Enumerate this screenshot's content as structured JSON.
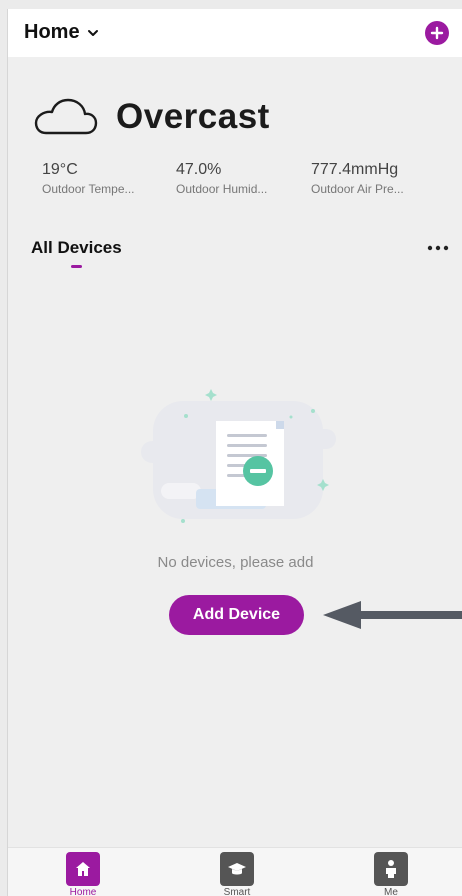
{
  "header": {
    "home_label": "Home",
    "add_icon": "plus-circle-icon"
  },
  "weather": {
    "condition": "Overcast",
    "icon": "cloud-icon",
    "stats": [
      {
        "value": "19°C",
        "label": "Outdoor Tempe..."
      },
      {
        "value": "47.0%",
        "label": "Outdoor Humid..."
      },
      {
        "value": "777.4mmHg",
        "label": "Outdoor Air Pre..."
      }
    ]
  },
  "devices": {
    "section_title": "All Devices",
    "more_icon": "more-icon",
    "empty_message": "No devices, please add",
    "add_button_label": "Add Device"
  },
  "nav": {
    "items": [
      {
        "label": "Home",
        "icon": "home-icon",
        "active": true
      },
      {
        "label": "Smart",
        "icon": "graduation-cap-icon",
        "active": false
      },
      {
        "label": "Me",
        "icon": "person-icon",
        "active": false
      }
    ]
  },
  "colors": {
    "accent": "#9b1aa0",
    "inactive_icon": "#555555",
    "background": "#efefef"
  }
}
